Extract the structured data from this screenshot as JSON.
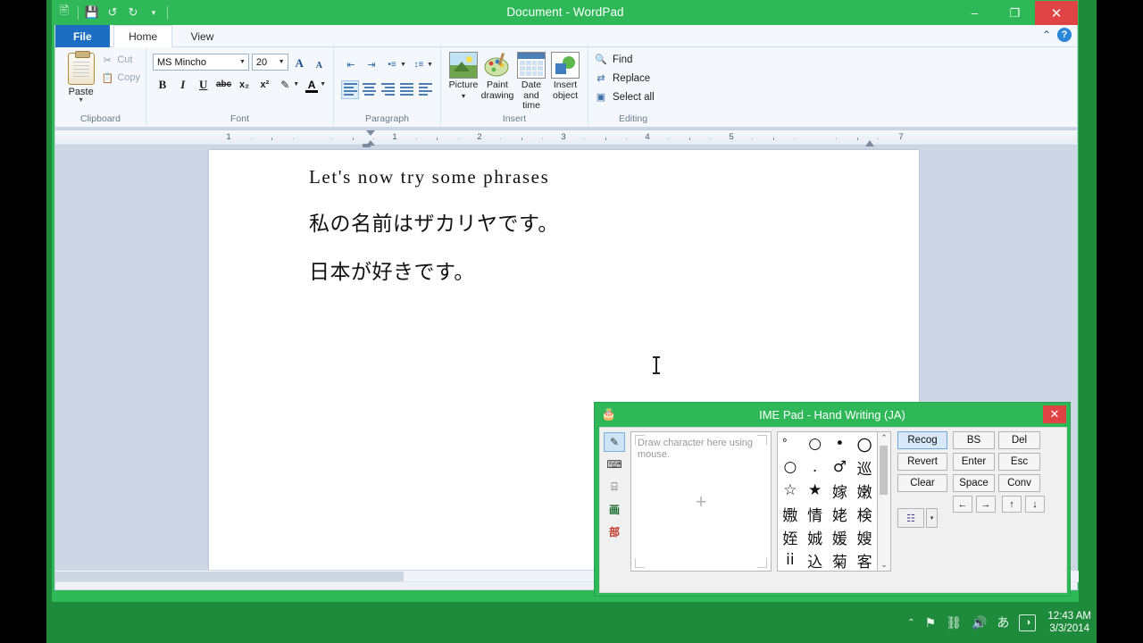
{
  "window": {
    "title": "Document - WordPad",
    "quick_access": [
      "wordpad-icon",
      "save-icon",
      "undo-icon",
      "redo-icon",
      "customize-icon"
    ],
    "controls": {
      "minimize": "–",
      "maximize": "❐",
      "close": "✕"
    }
  },
  "ribbon": {
    "tabs": [
      {
        "label": "File",
        "id": "file"
      },
      {
        "label": "Home",
        "id": "home"
      },
      {
        "label": "View",
        "id": "view"
      }
    ],
    "collapse_label": "⌃",
    "help_label": "?",
    "groups": {
      "clipboard": {
        "label": "Clipboard",
        "paste": "Paste",
        "paste_arrow": "▾",
        "cut": "Cut",
        "copy": "Copy"
      },
      "font": {
        "label": "Font",
        "font_name": "MS Mincho",
        "font_size": "20",
        "grow_label": "A",
        "shrink_label": "A",
        "bold": "B",
        "italic": "I",
        "underline": "U",
        "strikethrough": "abc",
        "subscript": "x₂",
        "superscript": "x²",
        "highlight": "✎",
        "text_color": "A",
        "highlight_color": "#f2e14c",
        "text_color_value": "#000000"
      },
      "paragraph": {
        "label": "Paragraph",
        "decrease_indent": "⇤",
        "increase_indent": "⇥",
        "bullets": "•≡",
        "line_spacing": "↕≡",
        "align_left": "≡",
        "align_center": "≡",
        "align_right": "≡",
        "justify": "≡",
        "paragraph_settings": "¶"
      },
      "insert": {
        "label": "Insert",
        "items": [
          {
            "label": "Picture",
            "sub": "▾",
            "icon": "picture-icon"
          },
          {
            "label": "Paint",
            "sub": "drawing",
            "icon": "paint-drawing-icon"
          },
          {
            "label": "Date and",
            "sub": "time",
            "icon": "date-time-icon"
          },
          {
            "label": "Insert",
            "sub": "object",
            "icon": "insert-object-icon"
          }
        ]
      },
      "editing": {
        "label": "Editing",
        "find": "Find",
        "replace": "Replace",
        "select_all": "Select all"
      }
    }
  },
  "ruler": {
    "numbers": [
      "1",
      "1",
      "2",
      "3",
      "4",
      "5",
      "7"
    ]
  },
  "document": {
    "lines": [
      "Let's now try some phrases",
      "私の名前はザカリヤです。",
      "日本が好きです。"
    ]
  },
  "status_bar": {
    "zoom_out": "−",
    "zoom_in": "+"
  },
  "ime_pad": {
    "title": "IME Pad - Hand Writing (JA)",
    "close": "✕",
    "app_icon": "ime-pad-icon",
    "sidebar": [
      {
        "id": "hand-writing",
        "glyph": "✎",
        "selected": true
      },
      {
        "id": "soft-keyboard",
        "glyph": "⌨",
        "selected": false
      },
      {
        "id": "character-list",
        "glyph": "⌸",
        "selected": false
      },
      {
        "id": "stroke-count",
        "glyph": "画",
        "selected": false
      },
      {
        "id": "radical",
        "glyph": "部",
        "selected": false
      }
    ],
    "canvas_hint": "Draw character here using mouse.",
    "canvas_cross": "+",
    "candidates": [
      "゜",
      "○",
      "•",
      "〇",
      "○",
      ".",
      "♂",
      "巡",
      "☆",
      "★",
      "嫁",
      "嫩",
      "嫐",
      "情",
      "姥",
      "検",
      "姪",
      "娍",
      "媛",
      "嫂",
      "ii",
      "込",
      "菊",
      "客"
    ],
    "scroll_up": "⌃",
    "scroll_down": "⌄",
    "actions": [
      "Recog",
      "Revert",
      "Clear"
    ],
    "selected_action": "Recog",
    "options_icon": "ime-options-icon",
    "options_arrow": "▾",
    "keys": [
      [
        "BS",
        "Del"
      ],
      [
        "Enter",
        "Esc"
      ],
      [
        "Space",
        "Conv"
      ]
    ],
    "arrow_keys": [
      "←",
      "→",
      "↑",
      "↓"
    ]
  },
  "taskbar": {
    "tray_icons": [
      {
        "id": "show-hidden-icons",
        "glyph": "⌃"
      },
      {
        "id": "action-center-flag-icon",
        "glyph": "⚑"
      },
      {
        "id": "network-icon",
        "glyph": "⛓"
      },
      {
        "id": "volume-icon",
        "glyph": "🔊"
      },
      {
        "id": "ime-mode-icon",
        "glyph": "あ"
      },
      {
        "id": "ime-pad-tray-icon",
        "glyph": "◑"
      }
    ],
    "time": "12:43 AM",
    "date": "3/3/2014"
  },
  "colors": {
    "accent_green": "#2eb858",
    "desktop_green": "#1e8a3c",
    "file_tab_blue": "#1b6ec2",
    "close_red": "#e04343",
    "doc_background": "#ccd6e5"
  }
}
